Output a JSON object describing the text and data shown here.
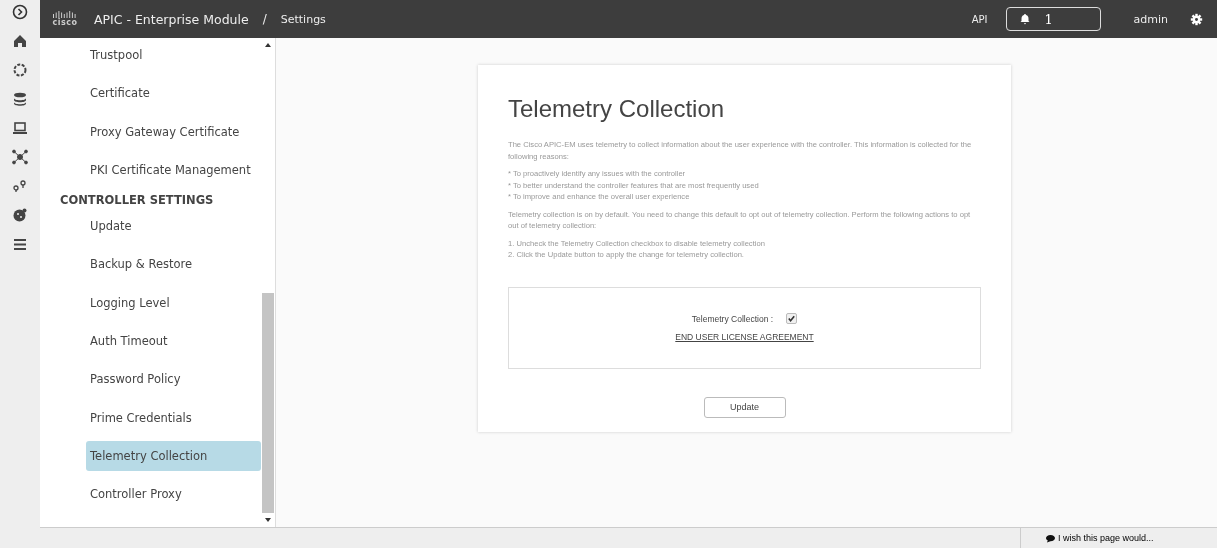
{
  "header": {
    "logo_text": "cisco",
    "app_title": "APIC - Enterprise Module",
    "separator": "/",
    "page": "Settings",
    "api_link": "API",
    "notifications_count": "1",
    "user": "admin"
  },
  "rail": [
    {
      "kind": "expand"
    },
    {
      "kind": "home"
    },
    {
      "kind": "ring"
    },
    {
      "kind": "database"
    },
    {
      "kind": "laptop"
    },
    {
      "kind": "network"
    },
    {
      "kind": "pins"
    },
    {
      "kind": "cookie"
    },
    {
      "kind": "sliders"
    }
  ],
  "sidebar": [
    {
      "kind": "item",
      "label": "Trustpool",
      "selected": false
    },
    {
      "kind": "item",
      "label": "Certificate",
      "selected": false
    },
    {
      "kind": "item",
      "label": "Proxy Gateway Certificate",
      "selected": false
    },
    {
      "kind": "item",
      "label": "PKI Certificate Management",
      "selected": false
    },
    {
      "kind": "heading",
      "label": "CONTROLLER SETTINGS"
    },
    {
      "kind": "item",
      "label": "Update",
      "selected": false
    },
    {
      "kind": "item",
      "label": "Backup & Restore",
      "selected": false
    },
    {
      "kind": "item",
      "label": "Logging Level",
      "selected": false
    },
    {
      "kind": "item",
      "label": "Auth Timeout",
      "selected": false
    },
    {
      "kind": "item",
      "label": "Password Policy",
      "selected": false
    },
    {
      "kind": "item",
      "label": "Prime Credentials",
      "selected": false
    },
    {
      "kind": "item",
      "label": "Telemetry Collection",
      "selected": true
    },
    {
      "kind": "item",
      "label": "Controller Proxy",
      "selected": false
    }
  ],
  "card": {
    "title": "Telemetry Collection",
    "paragraphs": [
      [
        "The Cisco APIC-EM uses telemetry to collect information about the user experience with the controller. This information is collected for the following reasons:"
      ],
      [
        "* To proactively identify any issues with the controller",
        "* To better understand the controller features that are most frequently used",
        "* To improve and enhance the overall user experience"
      ],
      [
        "Telemetry collection is on by default. You need to change this default to opt out of telemetry collection. Perform the following actions to opt out of telemetry collection:"
      ],
      [
        "1. Uncheck the Telemetry Collection checkbox to disable telemetry collection",
        "2. Click the Update button to apply the change for telemetry collection."
      ]
    ],
    "checkbox_label": "Telemetry Collection :",
    "checked": true,
    "license_link": "END USER LICENSE AGREEMENT",
    "button": "Update"
  },
  "feedback": "I wish this page would..."
}
